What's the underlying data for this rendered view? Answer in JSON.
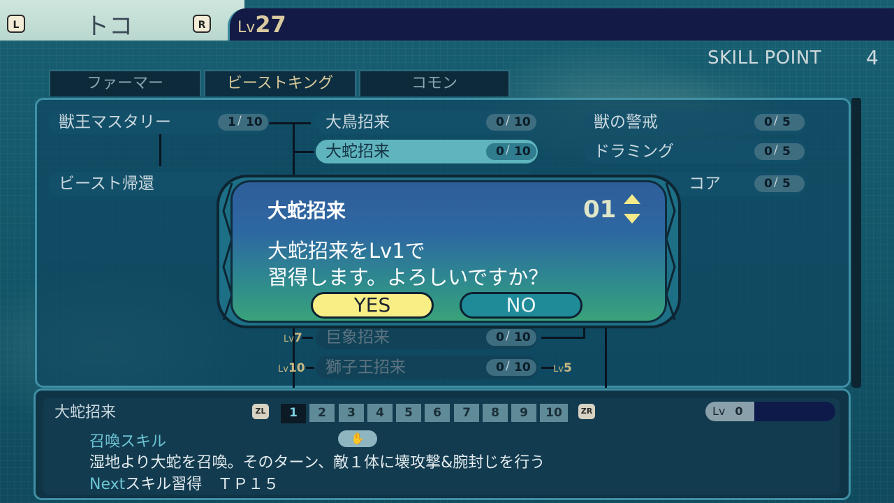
{
  "header": {
    "l_button": "L",
    "r_button": "R",
    "character_name": "トコ",
    "level_label": "Lv",
    "level_value": "27",
    "skill_point_label": "SKILL POINT",
    "skill_point_value": "4"
  },
  "tabs": [
    {
      "label": "ファーマー"
    },
    {
      "label": "ビーストキング"
    },
    {
      "label": "コモン"
    }
  ],
  "skills": [
    {
      "name": "獣王マスタリー",
      "cur": "1",
      "max": "10"
    },
    {
      "name": "ビースト帰還",
      "cur": "",
      "max": ""
    },
    {
      "name": "大鳥招来",
      "cur": "0",
      "max": "10"
    },
    {
      "name": "大蛇招来",
      "cur": "0",
      "max": "10"
    },
    {
      "name": "",
      "cur": "0",
      "max": "10"
    },
    {
      "name": "巨象招来",
      "cur": "0",
      "max": "10"
    },
    {
      "name": "獅子王招来",
      "cur": "0",
      "max": "10"
    },
    {
      "name": "獣の警戒",
      "cur": "0",
      "max": "5"
    },
    {
      "name": "ドラミング",
      "cur": "0",
      "max": "5"
    },
    {
      "name": "コア",
      "cur": "0",
      "max": "5"
    }
  ],
  "requirements": {
    "lv7": {
      "prefix": "Lv",
      "num": "7"
    },
    "lv10": {
      "prefix": "Lv",
      "num": "10"
    },
    "lv5": {
      "prefix": "Lv",
      "num": "5"
    }
  },
  "dialog": {
    "title": "大蛇招来",
    "quantity": "01",
    "message": "大蛇招来をLv1で\n習得します。よろしいですか？",
    "yes_label": "YES",
    "no_label": "NO"
  },
  "detail": {
    "title": "大蛇招来",
    "zl": "ZL",
    "zr": "ZR",
    "levels": [
      "1",
      "2",
      "3",
      "4",
      "5",
      "6",
      "7",
      "8",
      "9",
      "10"
    ],
    "level_label": "Lv",
    "level_value": "0",
    "type": "召喚スキル",
    "hand_icon": "✋",
    "description": "湿地より大蛇を召喚。そのターン、敵１体に壊攻撃&腕封じを行う",
    "next_label": "Next",
    "next_text": "スキル習得　ＴＰ１５"
  },
  "colors": {
    "yes_button": "#f8ee86",
    "no_button": "#1f8b99",
    "selected_skill": "#5fb4bd"
  }
}
